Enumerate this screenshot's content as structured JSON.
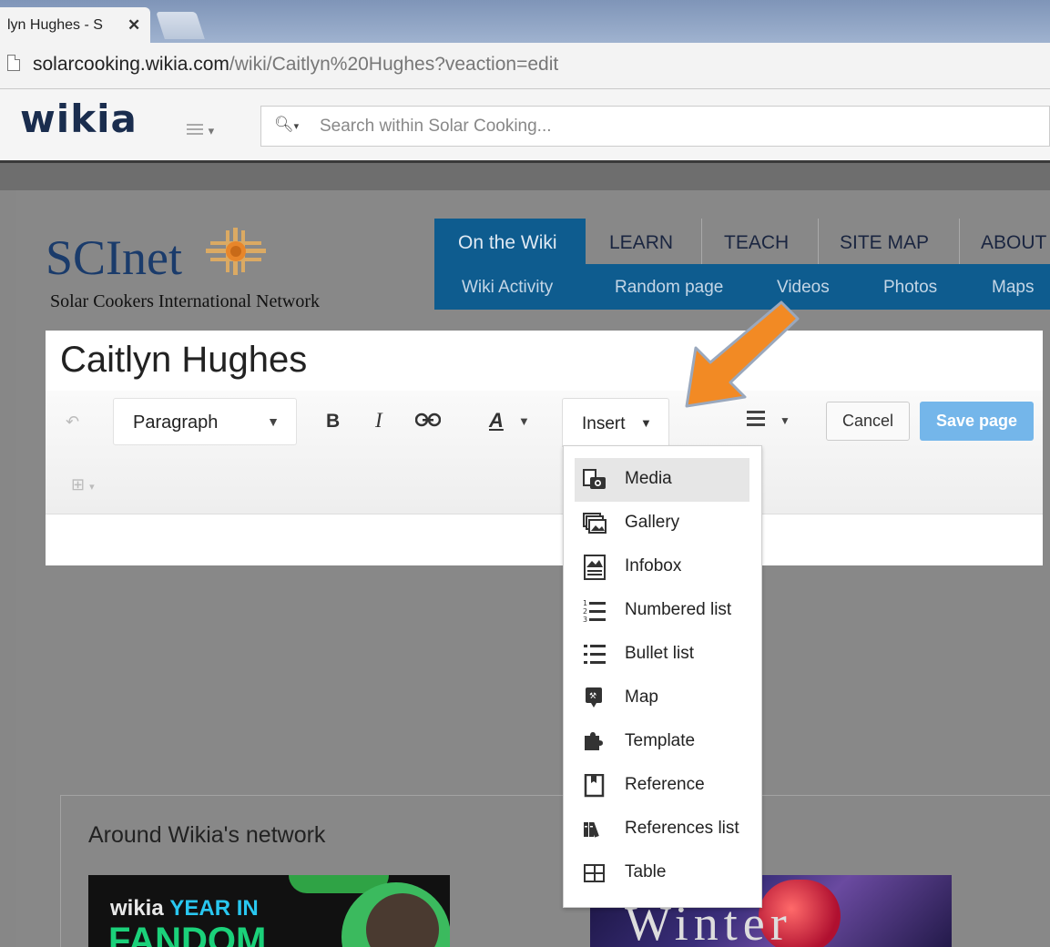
{
  "browser": {
    "tab_title": "lyn Hughes - S",
    "tab_close": "✕",
    "url_host": "solarcooking.wikia.com",
    "url_path": "/wiki/Caitlyn%20Hughes?veaction=edit"
  },
  "wikia_bar": {
    "logo": "wikia",
    "search_placeholder": "Search within Solar Cooking..."
  },
  "site": {
    "logo": "SCInet",
    "subtitle": "Solar Cookers International Network"
  },
  "nav": {
    "tabs": [
      "On the Wiki",
      "LEARN",
      "TEACH",
      "SITE MAP",
      "ABOUT"
    ],
    "subnav": [
      "Wiki Activity",
      "Random page",
      "Videos",
      "Photos",
      "Maps"
    ]
  },
  "editor": {
    "page_title": "Caitlyn Hughes",
    "paragraph_label": "Paragraph",
    "bold": "B",
    "italic": "I",
    "text_style": "A",
    "insert_label": "Insert",
    "cancel": "Cancel",
    "save": "Save page"
  },
  "insert_menu": {
    "items": [
      {
        "label": "Media",
        "icon": "media-icon"
      },
      {
        "label": "Gallery",
        "icon": "gallery-icon"
      },
      {
        "label": "Infobox",
        "icon": "infobox-icon"
      },
      {
        "label": "Numbered list",
        "icon": "numbered-list-icon"
      },
      {
        "label": "Bullet list",
        "icon": "bullet-list-icon"
      },
      {
        "label": "Map",
        "icon": "map-icon"
      },
      {
        "label": "Template",
        "icon": "template-icon"
      },
      {
        "label": "Reference",
        "icon": "reference-icon"
      },
      {
        "label": "References list",
        "icon": "references-list-icon"
      },
      {
        "label": "Table",
        "icon": "table-icon"
      }
    ],
    "highlighted": "Media"
  },
  "network": {
    "title": "Around Wikia's network",
    "thumb1_line1": "wikia",
    "thumb1_line1b": "YEAR IN",
    "thumb1_line2": "FANDOM",
    "thumb2_text": "Winter"
  },
  "colors": {
    "nav_active": "#0e5c8f",
    "save_button": "#74b6ea",
    "annotation_arrow": "#f28a24"
  }
}
